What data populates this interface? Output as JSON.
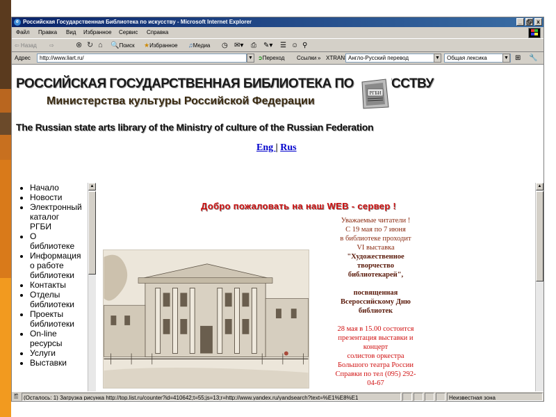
{
  "window": {
    "title": "Российская Государственная Библиотека по искусству - Microsoft Internet Explorer",
    "controls": [
      "_",
      " ",
      "x"
    ]
  },
  "menu": [
    "Файл",
    "Правка",
    "Вид",
    "Избранное",
    "Сервис",
    "Справка"
  ],
  "toolbar": {
    "back": "⇦ Назад",
    "forward": "⇨",
    "search": "Поиск",
    "favorites": "Избранное",
    "media": "Медиа"
  },
  "address": {
    "label": "Адрес",
    "url": "http://www.liart.ru/",
    "go": "Переход",
    "links": "Ссылки",
    "xtrans": "XTRANS",
    "translate_value": "Англо-Русский перевод",
    "lexicon_value": "Общая лексика"
  },
  "page": {
    "title_ru": "РОССИЙСКАЯ ГОСУДАРСТВЕННАЯ БИБЛИОТЕКА  ПО ИСКУССТВУ",
    "ministry": "Министерства культуры Российской Федерации",
    "title_en": "The Russian state arts library of the Ministry of culture of the Russian Federation",
    "logo_text": "РГБИ",
    "lang": {
      "eng": "Eng ",
      "sep": "|",
      "rus": "Rus"
    },
    "welcome": "Добро пожаловать на наш WEB - сервер !"
  },
  "nav": [
    [
      "Начало"
    ],
    [
      "Новости"
    ],
    [
      "Электронный",
      "каталог",
      "РГБИ"
    ],
    [
      "О",
      "библиотеке"
    ],
    [
      "Информация",
      "о работе",
      "библиотеки"
    ],
    [
      "Контакты"
    ],
    [
      "Отделы",
      "библиотеки"
    ],
    [
      "Проекты",
      "библиотеки"
    ],
    [
      "On-line",
      "ресурсы"
    ],
    [
      "Услуги"
    ],
    [
      "Выставки"
    ]
  ],
  "notice": {
    "l1": "Уважаемые читатели !",
    "l2": "С 19 мая по 7 июня",
    "l3": "в библиотеке проходит",
    "l4": "VI выставка",
    "b1": "\"Художественное",
    "b2": "творчество",
    "b3": "библиотекарей\",",
    "b4": "посвященная",
    "l5": "Всероссийскому Дню",
    "l6": "библиотек",
    "r1": "28 мая в 15.00 состоится",
    "l7": "презентация выставки и",
    "l8": "концерт",
    "l9": "солистов оркестра",
    "l10": "Большого театра России",
    "l11": "Справки по тел (095) 292-",
    "l12": "04-67"
  },
  "status": {
    "text": "(Осталось: 1) Загрузка рисунка http://top.list.ru/counter?id=410642;t=55;js=13;r=http://www.yandex.ru/yandsearch?text=%E1%E8%E1",
    "zone": "Неизвестная зона"
  }
}
